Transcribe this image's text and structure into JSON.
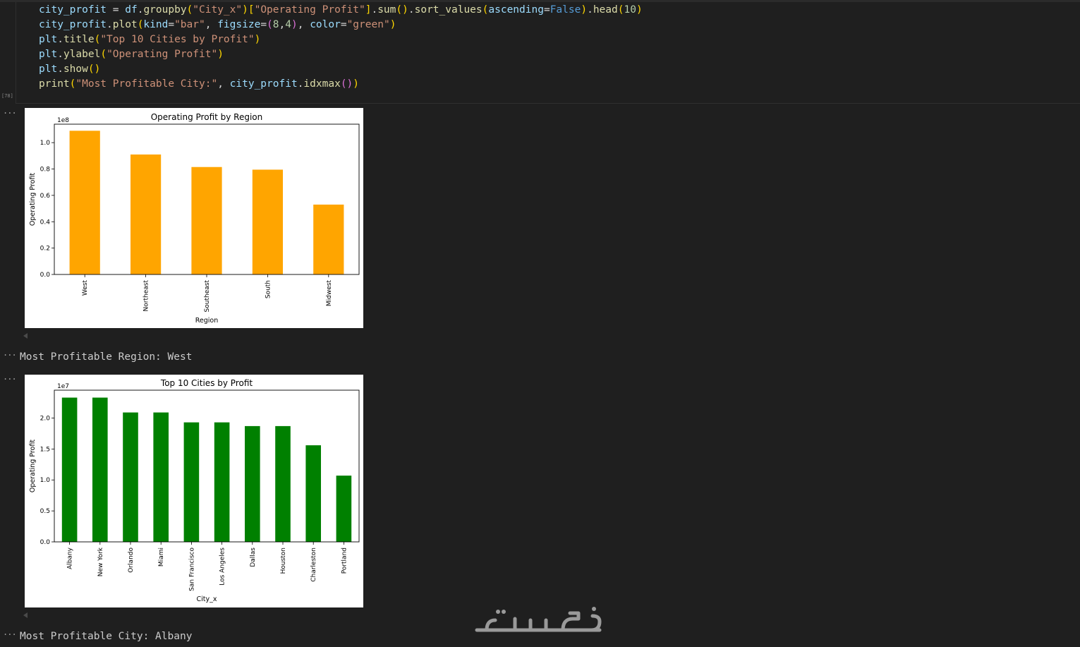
{
  "cell": {
    "execution_count": "[78]",
    "code_lines": [
      [
        [
          "city_profit",
          "v"
        ],
        [
          " = ",
          ""
        ],
        [
          "df",
          "v"
        ],
        [
          ".",
          ""
        ],
        [
          "groupby",
          "f"
        ],
        [
          "(",
          "p1"
        ],
        [
          "\"City_x\"",
          "s"
        ],
        [
          ")",
          "p1"
        ],
        [
          "[",
          "p1"
        ],
        [
          "\"Operating Profit\"",
          "s"
        ],
        [
          "]",
          "p1"
        ],
        [
          ".",
          ""
        ],
        [
          "sum",
          "f"
        ],
        [
          "()",
          "p1"
        ],
        [
          ".",
          ""
        ],
        [
          "sort_values",
          "f"
        ],
        [
          "(",
          "p1"
        ],
        [
          "ascending",
          "v"
        ],
        [
          "=",
          ""
        ],
        [
          "False",
          "k"
        ],
        [
          ")",
          "p1"
        ],
        [
          ".",
          ""
        ],
        [
          "head",
          "f"
        ],
        [
          "(",
          "p1"
        ],
        [
          "10",
          "n"
        ],
        [
          ")",
          "p1"
        ]
      ],
      [
        [
          "city_profit",
          "v"
        ],
        [
          ".",
          ""
        ],
        [
          "plot",
          "f"
        ],
        [
          "(",
          "p1"
        ],
        [
          "kind",
          "v"
        ],
        [
          "=",
          ""
        ],
        [
          "\"bar\"",
          "s"
        ],
        [
          ", ",
          ""
        ],
        [
          "figsize",
          "v"
        ],
        [
          "=",
          ""
        ],
        [
          "(",
          "p2"
        ],
        [
          "8",
          "n"
        ],
        [
          ",",
          ""
        ],
        [
          "4",
          "n"
        ],
        [
          ")",
          "p2"
        ],
        [
          ", ",
          ""
        ],
        [
          "color",
          "v"
        ],
        [
          "=",
          ""
        ],
        [
          "\"green\"",
          "s"
        ],
        [
          ")",
          "p1"
        ]
      ],
      [
        [
          "plt",
          "v"
        ],
        [
          ".",
          ""
        ],
        [
          "title",
          "f"
        ],
        [
          "(",
          "p1"
        ],
        [
          "\"Top 10 Cities by Profit\"",
          "s"
        ],
        [
          ")",
          "p1"
        ]
      ],
      [
        [
          "plt",
          "v"
        ],
        [
          ".",
          ""
        ],
        [
          "ylabel",
          "f"
        ],
        [
          "(",
          "p1"
        ],
        [
          "\"Operating Profit\"",
          "s"
        ],
        [
          ")",
          "p1"
        ]
      ],
      [
        [
          "plt",
          "v"
        ],
        [
          ".",
          ""
        ],
        [
          "show",
          "f"
        ],
        [
          "()",
          "p1"
        ]
      ],
      [
        [
          "print",
          "f"
        ],
        [
          "(",
          "p1"
        ],
        [
          "\"Most Profitable City:\"",
          "s"
        ],
        [
          ", ",
          ""
        ],
        [
          "city_profit",
          "v"
        ],
        [
          ".",
          ""
        ],
        [
          "idxmax",
          "f"
        ],
        [
          "()",
          "p2"
        ],
        [
          ")",
          "p1"
        ]
      ]
    ]
  },
  "outputs": {
    "ellipsis": "...",
    "region_result": "Most Profitable Region: West",
    "city_result": "Most Profitable City: Albany"
  },
  "chart_data": [
    {
      "type": "bar",
      "title": "Operating Profit by Region",
      "xlabel": "Region",
      "ylabel": "Operating Profit",
      "offset_label": "1e8",
      "color": "#ffa500",
      "categories": [
        "West",
        "Northeast",
        "Southeast",
        "South",
        "Midwest"
      ],
      "values": [
        1.09,
        0.91,
        0.815,
        0.795,
        0.53
      ],
      "ylim": [
        0,
        1.14
      ],
      "yticks": [
        0.0,
        0.2,
        0.4,
        0.6,
        0.8,
        1.0
      ],
      "ytick_labels": [
        "0.0",
        "0.2",
        "0.4",
        "0.6",
        "0.8",
        "1.0"
      ]
    },
    {
      "type": "bar",
      "title": "Top 10 Cities by Profit",
      "xlabel": "City_x",
      "ylabel": "Operating Profit",
      "offset_label": "1e7",
      "color": "#008000",
      "categories": [
        "Albany",
        "New York",
        "Orlando",
        "Miami",
        "San Francisco",
        "Los Angeles",
        "Dallas",
        "Houston",
        "Charleston",
        "Portland"
      ],
      "values": [
        2.33,
        2.33,
        2.09,
        2.09,
        1.93,
        1.93,
        1.87,
        1.87,
        1.56,
        1.07
      ],
      "ylim": [
        0,
        2.45
      ],
      "yticks": [
        0.0,
        0.5,
        1.0,
        1.5,
        2.0
      ],
      "ytick_labels": [
        "0.0",
        "0.5",
        "1.0",
        "1.5",
        "2.0"
      ]
    }
  ],
  "watermark": {
    "text": "خمسات"
  }
}
